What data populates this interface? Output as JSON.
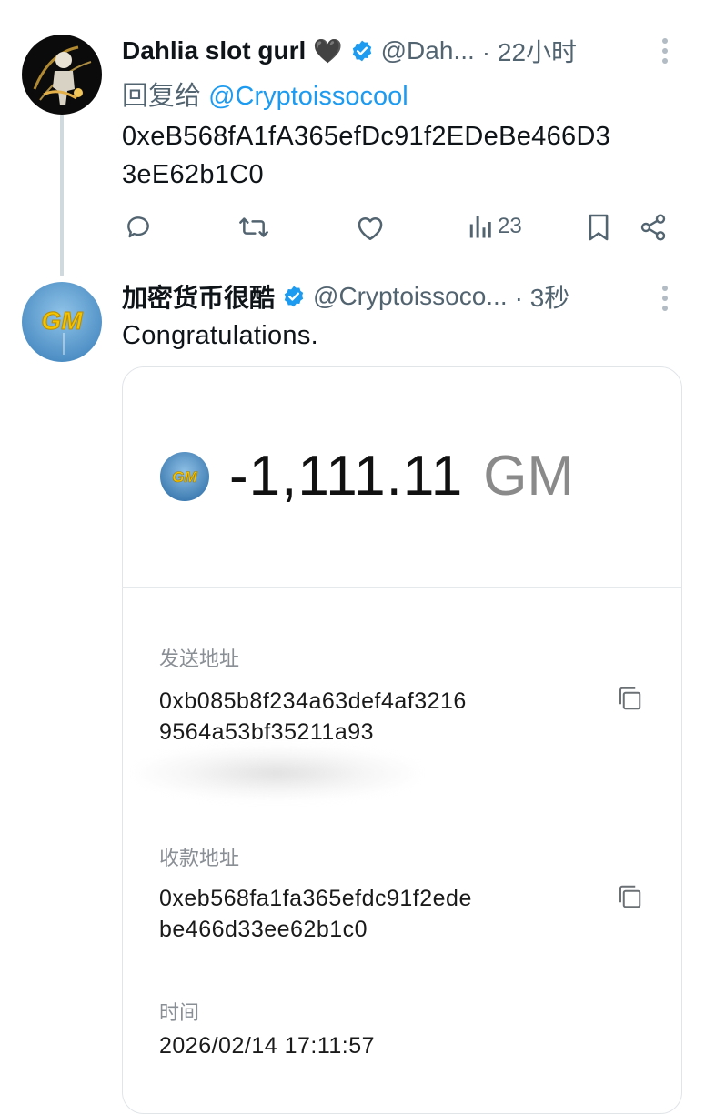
{
  "tweet1": {
    "display_name": "Dahlia slot gurl",
    "name_emoji": "🖤",
    "handle": "@Dah...",
    "time": "· 22小时",
    "reply_prefix": "回复给",
    "reply_mention": "@Cryptoissocool",
    "body_line1": "0xeB568fA1fA365efDc91f2EDeBe466D3",
    "body_line2": "3eE62b1C0",
    "actions": {
      "reply_icon": "reply-icon",
      "retweet_icon": "retweet-icon",
      "like_icon": "heart-icon",
      "views_icon": "views-icon",
      "views_count": "23",
      "bookmark_icon": "bookmark-icon",
      "share_icon": "share-icon"
    }
  },
  "tweet2": {
    "display_name": "加密货币很酷",
    "handle": "@Cryptoissoco...",
    "time": "· 3秒",
    "body": "Congratulations."
  },
  "card": {
    "coin_label": "GM",
    "amount": "-1,111.11",
    "unit": "GM",
    "sender_label": "发送地址",
    "sender_line1": "0xb085b8f234a63def4af3216",
    "sender_line2": "9564a53bf35211a93",
    "receiver_label": "收款地址",
    "receiver_line1": "0xeb568fa1fa365efdc91f2ede",
    "receiver_line2": "be466d33ee62b1c0",
    "time_label": "时间",
    "time_value": "2026/02/14 17:11:57"
  },
  "colors": {
    "link_blue": "#1d9bf0",
    "verified_blue": "#1d9bf0",
    "muted_gray": "#536471",
    "coin_yellow": "#f5c400"
  }
}
